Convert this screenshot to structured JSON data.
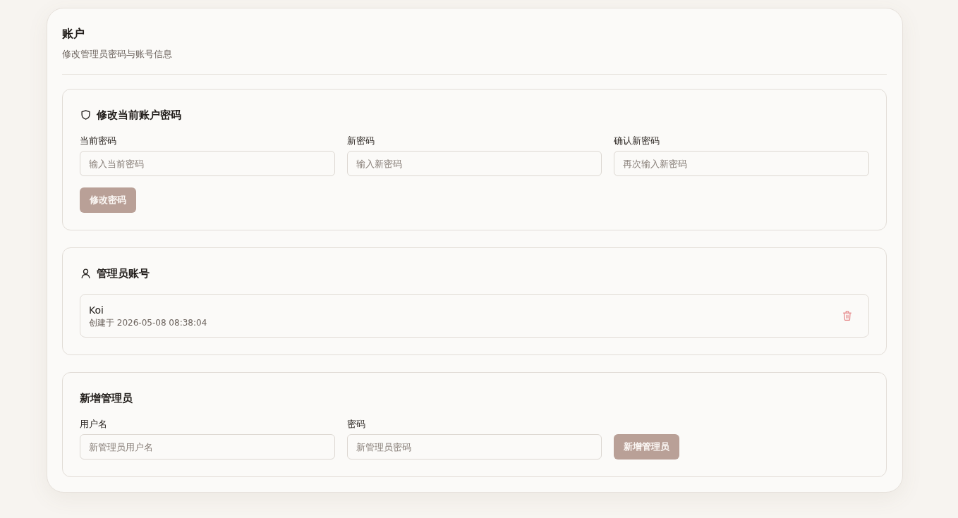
{
  "header": {
    "title": "账户",
    "subtitle": "修改管理员密码与账号信息"
  },
  "change_password": {
    "title": "修改当前账户密码",
    "fields": [
      {
        "label": "当前密码",
        "placeholder": "输入当前密码"
      },
      {
        "label": "新密码",
        "placeholder": "输入新密码"
      },
      {
        "label": "确认新密码",
        "placeholder": "再次输入新密码"
      }
    ],
    "button": {
      "label": "修改密码",
      "disabled": true
    }
  },
  "admin_accounts": {
    "title": "管理员账号",
    "accounts": [
      {
        "name": "Koi",
        "created": "创建于 2026-05-08 08:38:04"
      }
    ]
  },
  "add_admin": {
    "title": "新增管理员",
    "fields": [
      {
        "label": "用户名",
        "placeholder": "新管理员用户名"
      },
      {
        "label": "密码",
        "placeholder": "新管理员密码"
      }
    ],
    "button": {
      "label": "新增管理员",
      "disabled": true
    }
  }
}
